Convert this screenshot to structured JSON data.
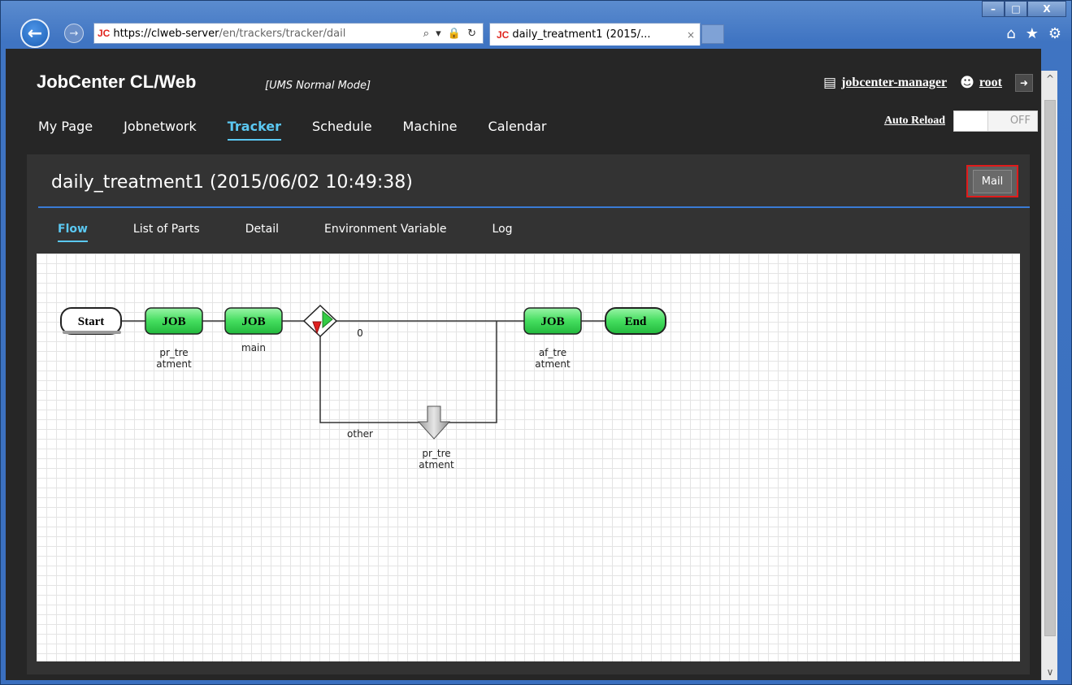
{
  "browser": {
    "address_host": "https://clweb-server",
    "address_path": "/en/trackers/tracker/dail",
    "address_tools": "⌕ ▾ 🔒 ↻",
    "tab_title": "daily_treatment1 (2015/...",
    "tab_close": "×",
    "jc_badge": "JC",
    "window_controls": {
      "minimize": "–",
      "maximize": "□",
      "close": "X"
    },
    "toolbar_icons": {
      "home": "⌂",
      "favorites": "★",
      "settings": "⚙"
    }
  },
  "app": {
    "brand": "JobCenter CL/Web",
    "mode": "[UMS Normal Mode]",
    "server_link": "jobcenter-manager",
    "user_link": "root",
    "menu": [
      "My Page",
      "Jobnetwork",
      "Tracker",
      "Schedule",
      "Machine",
      "Calendar"
    ],
    "active_menu": "Tracker",
    "auto_reload_label": "Auto Reload",
    "auto_reload_state": "OFF"
  },
  "tracker": {
    "title": "daily_treatment1 (2015/06/02 10:49:38)",
    "mail_label": "Mail",
    "tabs": [
      "Flow",
      "List of Parts",
      "Detail",
      "Environment Variable",
      "Log"
    ],
    "active_tab": "Flow"
  },
  "flow": {
    "start_label": "Start",
    "end_label": "End",
    "job1": {
      "text": "JOB",
      "name_line1": "pr_tre",
      "name_line2": "atment"
    },
    "job2": {
      "text": "JOB",
      "name_line1": "main"
    },
    "job3": {
      "text": "JOB",
      "name_line1": "af_tre",
      "name_line2": "atment"
    },
    "branch_zero": "0",
    "branch_other": "other",
    "arrow_name_line1": "pr_tre",
    "arrow_name_line2": "atment"
  },
  "colors": {
    "accent": "#5bc8f2",
    "mail_border": "#e01b1b",
    "job_green": "#3dd35a",
    "rule": "#3a7bd5"
  }
}
